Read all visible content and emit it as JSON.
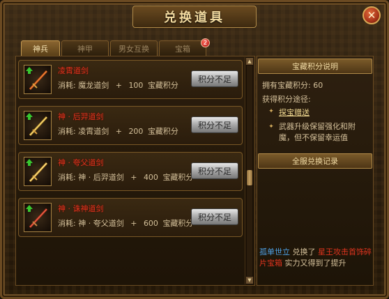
{
  "window": {
    "title": "兑换道具",
    "close_symbol": "✕"
  },
  "tabs": [
    {
      "label": "神兵",
      "active": true
    },
    {
      "label": "神甲",
      "active": false
    },
    {
      "label": "男女互换",
      "active": false
    },
    {
      "label": "宝箱",
      "active": false
    }
  ],
  "tab_badge": "2",
  "items": [
    {
      "name": "凌霄道剑",
      "cost_prefix": "消耗:",
      "cost_item": "魔龙道剑",
      "plus": "+",
      "points": "100",
      "points_unit": "宝藏积分",
      "button_label": "积分不足"
    },
    {
      "name": "神 · 后羿道剑",
      "cost_prefix": "消耗:",
      "cost_item": "凌霄道剑",
      "plus": "+",
      "points": "200",
      "points_unit": "宝藏积分",
      "button_label": "积分不足"
    },
    {
      "name": "神 · 夸父道剑",
      "cost_prefix": "消耗:",
      "cost_item": "神 · 后羿道剑",
      "plus": "+",
      "points": "400",
      "points_unit": "宝藏积分",
      "button_label": "积分不足"
    },
    {
      "name": "神 · 诛神道剑",
      "cost_prefix": "消耗:",
      "cost_item": "神 · 夸父道剑",
      "plus": "+",
      "points": "600",
      "points_unit": "宝藏积分",
      "button_label": "积分不足"
    }
  ],
  "side": {
    "points_header": "宝藏积分说明",
    "owned_label": "拥有宝藏积分: 60",
    "ways_label": "获得积分途径:",
    "way_link": "探宝赠送",
    "way_desc": "武器升级保留强化和附魔，但不保留幸运值",
    "log_header": "全服兑换记录",
    "log_user": "孤单世立",
    "log_mid": "兑换了",
    "log_item": "星王攻击首饰碎片宝箱",
    "log_tail": "实力又得到了提升"
  },
  "colors": {
    "item_name": "#e0341e",
    "user_name": "#4ea2e8",
    "accent_gold": "#f1dba4"
  }
}
